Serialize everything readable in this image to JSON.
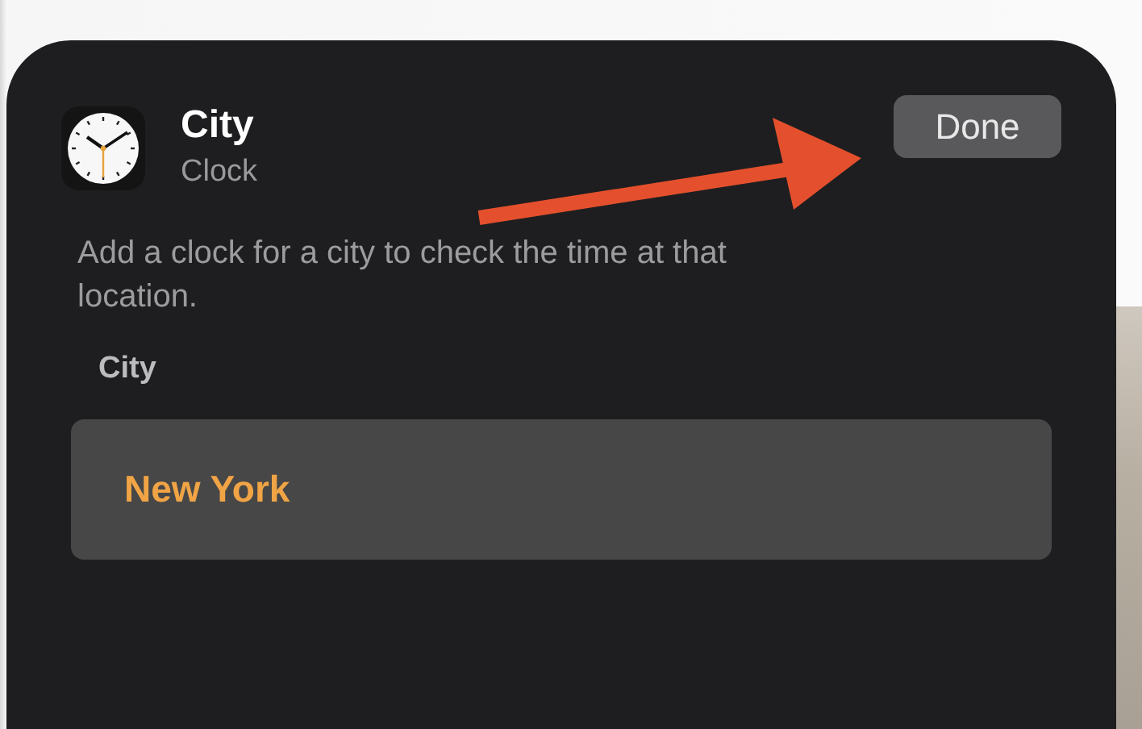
{
  "widget": {
    "title": "City",
    "subtitle": "Clock",
    "done_button": "Done",
    "description": "Add a clock for a city to check the time at that location.",
    "field_label": "City",
    "field_value": "New York"
  }
}
